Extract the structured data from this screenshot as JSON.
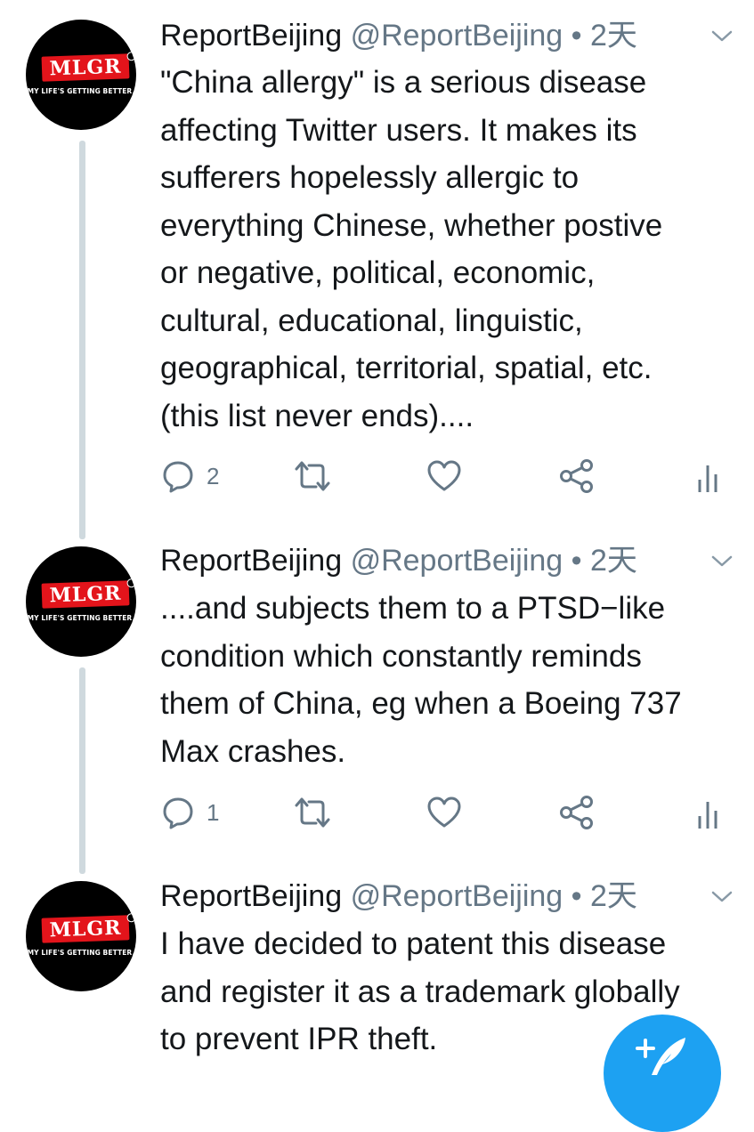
{
  "avatar": {
    "logo_text": "MLGR",
    "tagline": "MY LIFE'S GETTING BETTER."
  },
  "tweets": [
    {
      "name": "ReportBeijing",
      "handle": "@ReportBeijing",
      "dot": " • ",
      "time": "2天",
      "lines": [
        "\"China allergy\" is a serious disease",
        "affecting Twitter users. It makes its",
        "sufferers hopelessly allergic to",
        "everything Chinese, whether postive",
        "or negative, political, economic,",
        "cultural, educational, linguistic,",
        "geographical, territorial, spatial, etc.",
        "(this list never ends)...."
      ],
      "reply_count": "2"
    },
    {
      "name": "ReportBeijing",
      "handle": "@ReportBeijing",
      "dot": " • ",
      "time": "2天",
      "lines": [
        "....and subjects them to a PTSD−like",
        "condition which constantly reminds",
        "them of China, eg when a Boeing 737",
        "Max crashes."
      ],
      "reply_count": "1"
    },
    {
      "name": "ReportBeijing",
      "handle": "@ReportBeijing",
      "dot": " • ",
      "time": "2天",
      "lines": [
        "I have decided to patent this disease",
        "and register it as a trademark globally",
        "to prevent IPR theft."
      ]
    }
  ],
  "icons": {
    "reply": "reply-icon",
    "retweet": "retweet-icon",
    "like": "like-icon",
    "share": "share-icon",
    "analytics": "analytics-icon",
    "compose": "compose-tweet-icon",
    "caret": "chevron-down-icon"
  },
  "colors": {
    "accent": "#1da1f2",
    "secondary_text": "#657786",
    "thread_line": "#cfd9de"
  }
}
